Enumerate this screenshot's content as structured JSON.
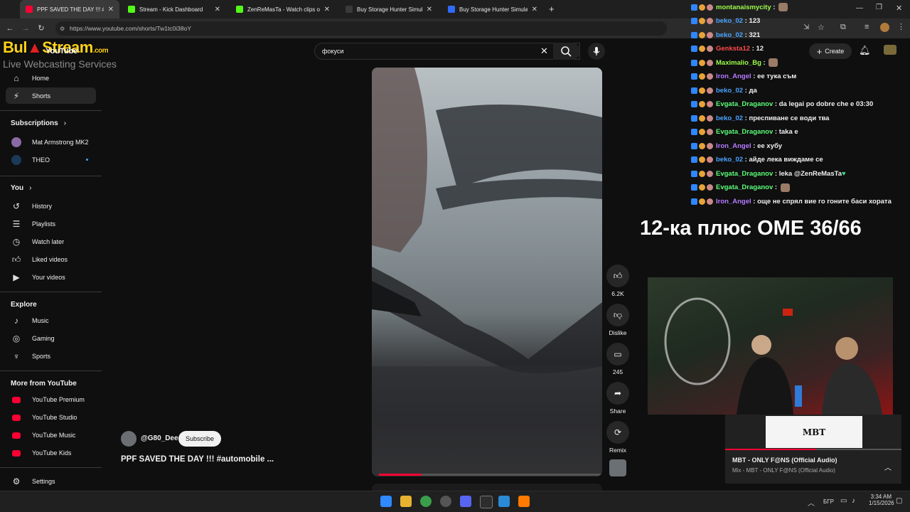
{
  "browser": {
    "tabs": [
      {
        "title": "PPF SAVED THE DAY !!! #au",
        "active": true,
        "icon": "youtube-icon",
        "color": "#ff0033"
      },
      {
        "title": "Stream - Kick Dashboard",
        "active": false,
        "icon": "kick-icon",
        "color": "#53fc18"
      },
      {
        "title": "ZenReMasTa - Watch clips on K",
        "active": false,
        "icon": "kick-icon",
        "color": "#53fc18"
      },
      {
        "title": "Buy Storage Hunter Simulator C",
        "active": false,
        "icon": "steam-icon",
        "color": "#3a3a3a"
      },
      {
        "title": "Buy Storage Hunter Simulator",
        "active": false,
        "icon": "store-icon",
        "color": "#2f6bff"
      }
    ],
    "new_tab": "+",
    "url": "https://www.youtube.com/shorts/Tw1tc0i38oY"
  },
  "overlay_logo": {
    "line1_a": "Bul",
    "line1_b": "Stream",
    "line1_c": ".com",
    "line2": "Live Webcasting Services"
  },
  "youtube": {
    "logo_text": "YouTube",
    "search": {
      "value": "фокуси"
    },
    "header": {
      "create_label": "Create"
    },
    "sidebar": {
      "main": [
        {
          "label": "Home",
          "icon": "home-icon"
        },
        {
          "label": "Shorts",
          "icon": "shorts-icon"
        }
      ],
      "subscriptions_title": "Subscriptions",
      "subscriptions": [
        {
          "label": "Mat Armstrong MK2"
        },
        {
          "label": "THEO"
        }
      ],
      "you_title": "You",
      "you": [
        {
          "label": "History",
          "icon": "history-icon"
        },
        {
          "label": "Playlists",
          "icon": "playlists-icon"
        },
        {
          "label": "Watch later",
          "icon": "clock-icon"
        },
        {
          "label": "Liked videos",
          "icon": "thumbs-up-icon"
        },
        {
          "label": "Your videos",
          "icon": "video-icon"
        }
      ],
      "explore_title": "Explore",
      "explore": [
        {
          "label": "Music",
          "icon": "music-icon"
        },
        {
          "label": "Gaming",
          "icon": "gaming-icon"
        },
        {
          "label": "Sports",
          "icon": "trophy-icon"
        }
      ],
      "more_title": "More from YouTube",
      "more": [
        {
          "label": "YouTube Premium"
        },
        {
          "label": "YouTube Studio"
        },
        {
          "label": "YouTube Music"
        },
        {
          "label": "YouTube Kids"
        }
      ],
      "settings_label": "Settings"
    },
    "short": {
      "channel": "@G80_Dee",
      "subscribe_label": "Subscribe",
      "title": "PPF SAVED THE DAY !!! #automobile ...",
      "progress": 0.19
    },
    "actions": {
      "likes": "6.2K",
      "dislike_label": "Dislike",
      "comments": "245",
      "share_label": "Share",
      "remix_label": "Remix"
    }
  },
  "chat": [
    {
      "user": "montanaismycity",
      "msg": "",
      "color": "#9cff4a"
    },
    {
      "user": "beko_02",
      "msg": "123",
      "color": "#4aa3ff"
    },
    {
      "user": "beko_02",
      "msg": "321",
      "color": "#4aa3ff"
    },
    {
      "user": "Genksta12",
      "msg": "12",
      "color": "#ff4a4a"
    },
    {
      "user": "Maximalio_Bg",
      "msg": "",
      "color": "#9cff4a"
    },
    {
      "user": "Iron_Angel",
      "msg": "ее тука съм",
      "color": "#b57bff"
    },
    {
      "user": "beko_02",
      "msg": "да",
      "color": "#4aa3ff"
    },
    {
      "user": "Evgata_Draganov",
      "msg": "da legai po dobre che e 03:30",
      "color": "#5cff7a"
    },
    {
      "user": "beko_02",
      "msg": "преспиване се води тва",
      "color": "#4aa3ff"
    },
    {
      "user": "Evgata_Draganov",
      "msg": "taka e",
      "color": "#5cff7a"
    },
    {
      "user": "Iron_Angel",
      "msg": "ее хубу",
      "color": "#b57bff"
    },
    {
      "user": "beko_02",
      "msg": "айде лека виждаме се",
      "color": "#4aa3ff"
    },
    {
      "user": "Evgata_Draganov",
      "msg": "leka @ZenReMasTa",
      "color": "#5cff7a"
    },
    {
      "user": "Evgata_Draganov",
      "msg": "",
      "color": "#5cff7a"
    },
    {
      "user": "Iron_Angel",
      "msg": "още не спрял вие го гоните баси хората",
      "color": "#b57bff"
    }
  ],
  "overlay_score": "12-ка плюс OME 36/66",
  "mini_player": {
    "title": "MBT - ONLY F@NS (Official Audio)",
    "subtitle": "Mix - MBT - ONLY F@NS (Official Audio)",
    "cover_text": "MBT"
  },
  "taskbar": {
    "lang": "БГР",
    "time": "3:34 AM",
    "date": "1/15/2026"
  }
}
